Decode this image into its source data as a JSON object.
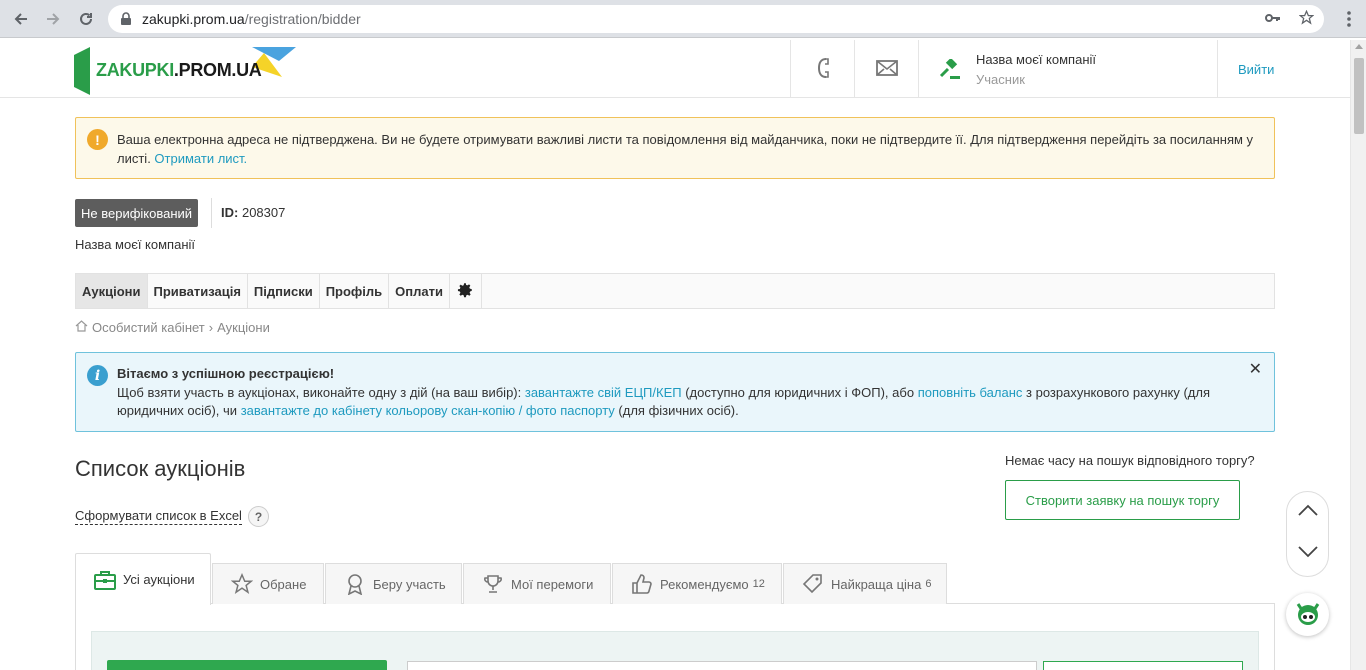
{
  "browser": {
    "url_host": "zakupki.prom.ua",
    "url_path": "/registration/bidder"
  },
  "header": {
    "logo_text_green": "ZAKUPKI",
    "logo_text_dark": ".PROM.UA",
    "company_name": "Назва моєї компанії",
    "company_role": "Учасник",
    "exit_label": "Вийти"
  },
  "warning": {
    "text": "Ваша електронна адреса не підтверджена. Ви не будете отримувати важливі листи та повідомлення від майданчика, поки не підтвердите її. Для підтвердження перейдіть за посиланням у листі. ",
    "link": "Отримати лист."
  },
  "profile": {
    "badge": "Не верифікований",
    "id_label": "ID:",
    "id_value": "208307",
    "company": "Назва моєї компанії"
  },
  "nav": {
    "items": [
      "Аукціони",
      "Приватизація",
      "Підписки",
      "Профіль",
      "Оплати"
    ]
  },
  "breadcrumb": {
    "home": "Особистий кабінет",
    "sep": "›",
    "current": "Аукціони"
  },
  "info": {
    "title": "Вітаємо з успішною реєстрацією!",
    "t1": "Щоб взяти участь в аукціонах, виконайте одну з дій (на ваш вибір): ",
    "l1": "завантажте свій ЕЦП/КЕП",
    "t2": " (доступно для юридичних і ФОП), або ",
    "l2": "поповніть баланс",
    "t3": " з розрахункового рахунку (для юридичних осіб), чи ",
    "l3": "завантажте до кабінету кольорову скан-копію / фото паспорту",
    "t4": " (для фізичних осіб).",
    "close": "✕"
  },
  "main": {
    "title": "Список аукціонів",
    "excel_link": "Сформувати список в Excel",
    "help": "?",
    "no_time": "Немає часу на пошук відповідного торгу?",
    "create_button": "Створити заявку на пошук торгу"
  },
  "tabs": [
    {
      "label": "Усі аукціони",
      "count": "",
      "icon": "briefcase-icon"
    },
    {
      "label": "Обране",
      "count": "",
      "icon": "star-icon"
    },
    {
      "label": "Беру участь",
      "count": "",
      "icon": "medal-icon"
    },
    {
      "label": "Мої перемоги",
      "count": "",
      "icon": "trophy-icon"
    },
    {
      "label": "Рекомендуємо",
      "count": "12",
      "icon": "thumbs-up-icon"
    },
    {
      "label": "Найкраща ціна",
      "count": "6",
      "icon": "price-tag-icon"
    }
  ],
  "colors": {
    "brand_green": "#2a9d49",
    "link_blue": "#1e9abf",
    "warning_border": "#f0c25a",
    "info_border": "#6fc2dc"
  }
}
